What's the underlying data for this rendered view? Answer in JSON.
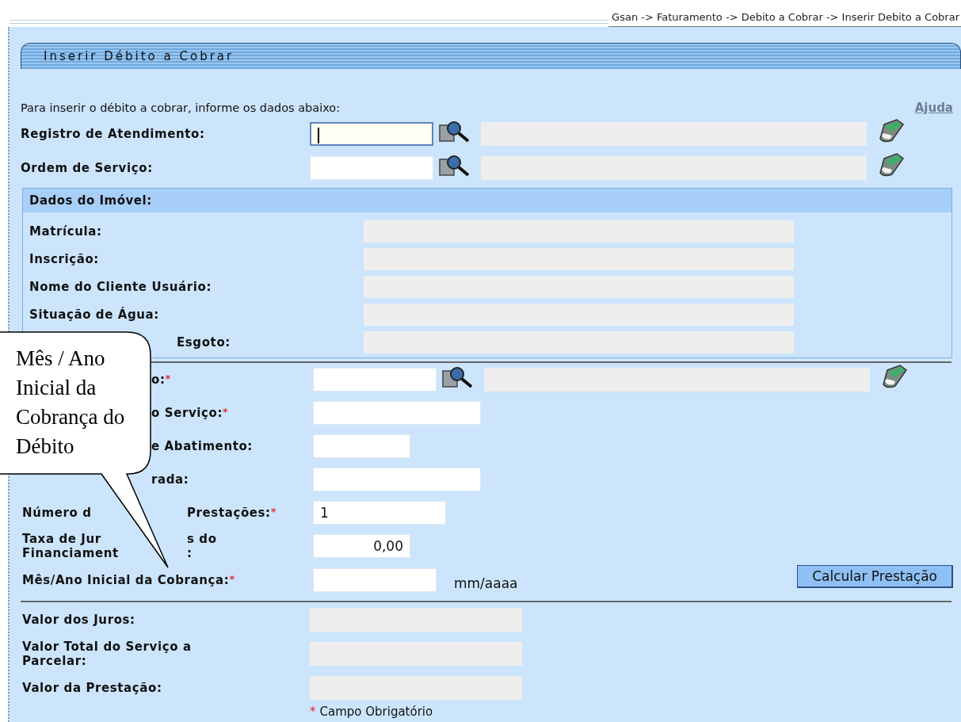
{
  "breadcrumb": "Gsan -> Faturamento -> Debito a Cobrar -> Inserir Debito a Cobrar",
  "title": "Inserir Débito a Cobrar",
  "intro": "Para inserir o débito a cobrar, informe os dados abaixo:",
  "help_link": "Ajuda",
  "required_mark": "*",
  "lookups": [
    {
      "label": "Registro de Atendimento:",
      "focused": true
    },
    {
      "label": "Ordem de Serviço:",
      "focused": false
    }
  ],
  "property_section": {
    "title": "Dados do Imóvel:",
    "fields": [
      {
        "label": "Matrícula:",
        "clipped": false
      },
      {
        "label": "Inscrição:",
        "clipped": false
      },
      {
        "label": "Nome do Cliente Usuário:",
        "clipped": false
      },
      {
        "label": "Situação de Água:",
        "clipped": false
      },
      {
        "label": "Esgoto:",
        "clipped": true
      }
    ]
  },
  "form_fields": [
    {
      "kind": "lookup",
      "label_lines": [
        [
          "o:"
        ]
      ],
      "clipped": true,
      "required": true
    },
    {
      "kind": "long",
      "label_lines": [
        [
          "o Serviço:"
        ]
      ],
      "clipped": true,
      "required": true
    },
    {
      "kind": "short",
      "label_lines": [
        [
          "e Abatimento:"
        ]
      ],
      "clipped": true,
      "required": false
    },
    {
      "kind": "long",
      "label_lines": [
        [
          "rada:"
        ]
      ],
      "clipped": true,
      "required": false
    },
    {
      "kind": "medium",
      "label_lines": [
        [
          "Número d",
          "Prestações:"
        ]
      ],
      "clipped": false,
      "required": true,
      "value": "1"
    },
    {
      "kind": "numeric",
      "label_lines": [
        [
          "Taxa de Jur",
          "s do"
        ],
        [
          "Financiament",
          ":"
        ]
      ],
      "clipped": false,
      "required": false,
      "value": "0,00"
    }
  ],
  "start_month": {
    "label": "Mês/Ano Inicial da Cobrança:",
    "required": true,
    "hint": "mm/aaaa"
  },
  "calculate_button": "Calcular Prestação",
  "results": [
    {
      "label": "Valor dos Juros:"
    },
    {
      "label": "Valor Total do Serviço a Parcelar:"
    },
    {
      "label": "Valor da Prestação:"
    }
  ],
  "footnote": {
    "mark": "*",
    "text": "Campo Obrigatório"
  },
  "callout": {
    "text": "Mês / Ano Inicial da Cobrança do Débito"
  }
}
